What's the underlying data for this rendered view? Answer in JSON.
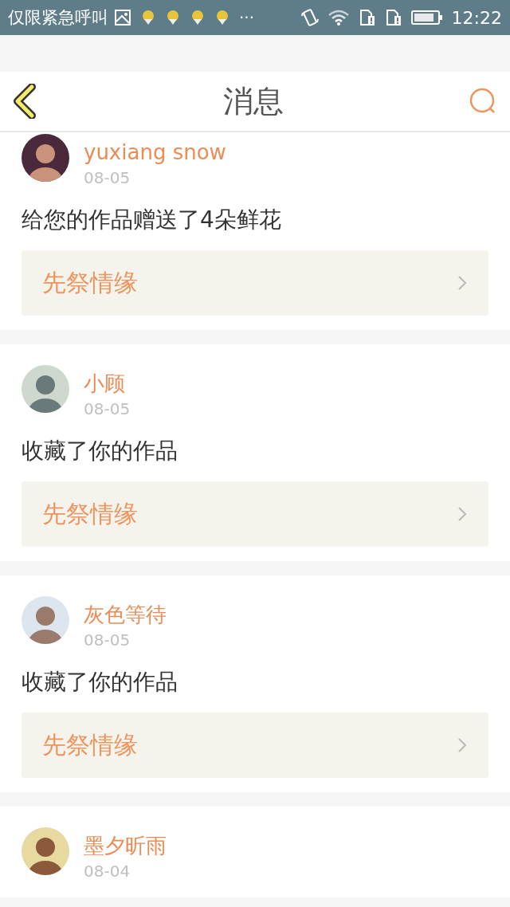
{
  "status_bar": {
    "carrier_text": "仅限紧急呼叫",
    "overflow": "···",
    "time": "12:22"
  },
  "header": {
    "title": "消息"
  },
  "messages": [
    {
      "name": "yuxiang snow",
      "date": "08-05",
      "text": "给您的作品赠送了4朵鲜花",
      "work_title": "先祭情缘"
    },
    {
      "name": "小顾",
      "date": "08-05",
      "text": "收藏了你的作品",
      "work_title": "先祭情缘"
    },
    {
      "name": "灰色等待",
      "date": "08-05",
      "text": "收藏了你的作品",
      "work_title": "先祭情缘"
    },
    {
      "name": "墨夕昕雨",
      "date": "08-04"
    }
  ]
}
